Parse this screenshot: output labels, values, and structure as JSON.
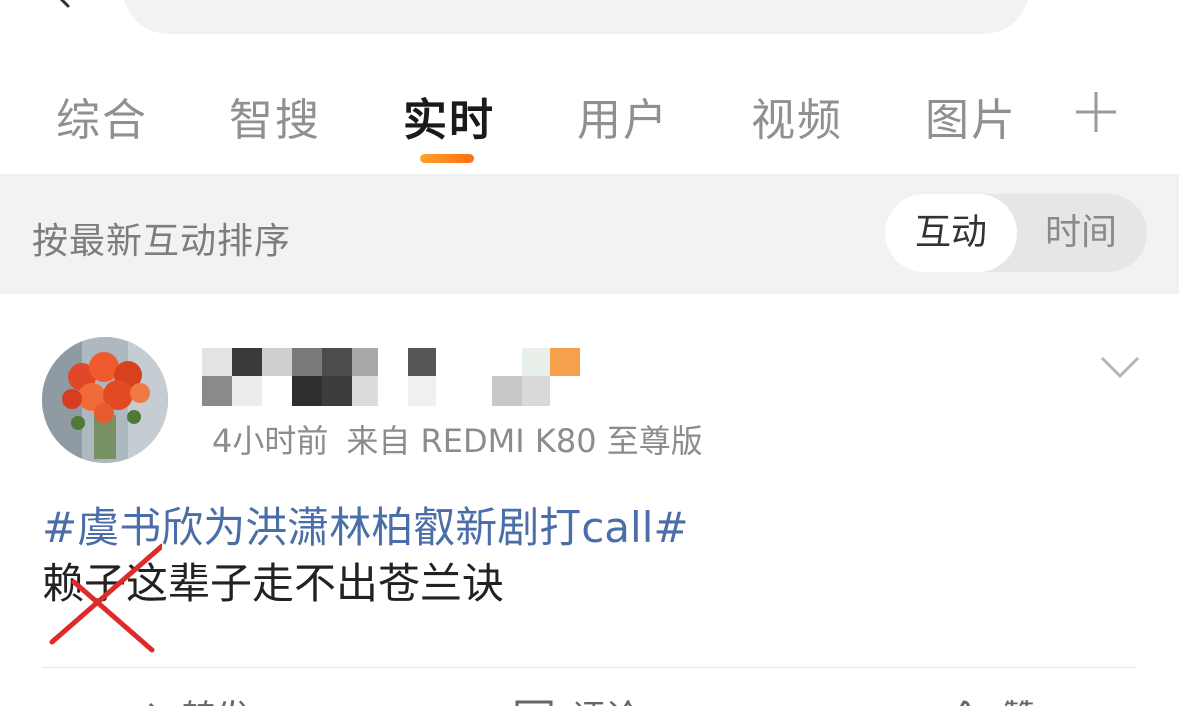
{
  "tabs": [
    {
      "label": "综合",
      "active": false
    },
    {
      "label": "智搜",
      "active": false
    },
    {
      "label": "实时",
      "active": true
    },
    {
      "label": "用户",
      "active": false
    },
    {
      "label": "视频",
      "active": false
    },
    {
      "label": "图片",
      "active": false
    }
  ],
  "sort_bar": {
    "label": "按最新互动排序",
    "options": [
      "互动",
      "时间"
    ],
    "selected": "互动"
  },
  "post": {
    "username": "",
    "time": "4小时前",
    "source": "来自 REDMI K80 至尊版",
    "hashtag": "#虞书欣为洪潇林柏叡新剧打call#",
    "text": "赖子这辈子走不出苍兰诀"
  },
  "actions": [
    {
      "label": "转发",
      "icon": "repost-icon"
    },
    {
      "label": "评论",
      "icon": "comment-icon"
    },
    {
      "label": "赞",
      "icon": "like-icon"
    }
  ],
  "colors": {
    "accent": "#ff8a1e",
    "hashtag": "#4b6ea8",
    "sort_bar_bg": "#f2f2f2"
  }
}
